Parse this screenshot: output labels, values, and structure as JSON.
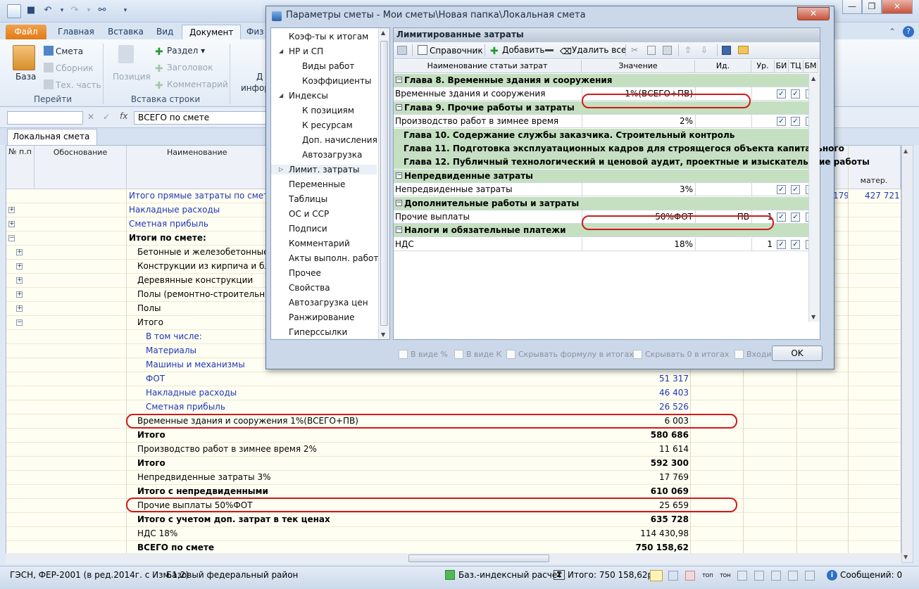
{
  "window": {
    "title_controls": [
      "—",
      "❐",
      "✕"
    ]
  },
  "ribbon": {
    "tabs": [
      "Файл",
      "Главная",
      "Вставка",
      "Вид",
      "Документ",
      "Физ"
    ],
    "active_tab": "Документ",
    "baza": "База",
    "smeta": "Смета",
    "sbornik": "Сборник",
    "tech_part": "Тех. часть",
    "group_go": "Перейти",
    "position": "Позиция",
    "section": "Раздел",
    "header": "Заголовок",
    "comment": "Комментарий",
    "group_insert": "Вставка строки",
    "cut_text1": "Д",
    "cut_text2": "инфор"
  },
  "formula_bar": {
    "fx": "fx",
    "value": "ВСЕГО по смете"
  },
  "doc_tab": {
    "label": "Локальная смета",
    "close": "✕"
  },
  "grid": {
    "headers": {
      "num": "№ п.п",
      "basis": "Обоснование",
      "name": "Наименование",
      "mater": "матер."
    },
    "rows": [
      {
        "name": "Итого прямые затраты по смете с у",
        "value": "",
        "style": "blue",
        "indent": 0,
        "pm": "",
        "extra1": "179",
        "extra2": "427 721"
      },
      {
        "name": "Накладные расходы",
        "value": "",
        "style": "blue",
        "indent": 0,
        "pm": "+"
      },
      {
        "name": "Сметная прибыль",
        "value": "",
        "style": "blue",
        "indent": 0,
        "pm": "+"
      },
      {
        "name": "Итоги по смете:",
        "value": "",
        "style": "b",
        "indent": 0,
        "pm": "−"
      },
      {
        "name": "Бетонные и железобетонные мон",
        "value": "",
        "style": "",
        "indent": 1,
        "pm": "+"
      },
      {
        "name": "Конструкции из кирпича и блоко",
        "value": "",
        "style": "",
        "indent": 1,
        "pm": "+"
      },
      {
        "name": "Деревянные конструкции",
        "value": "",
        "style": "",
        "indent": 1,
        "pm": "+"
      },
      {
        "name": "Полы (ремонтно-строительные)",
        "value": "",
        "style": "",
        "indent": 1,
        "pm": "+"
      },
      {
        "name": "Полы",
        "value": "",
        "style": "",
        "indent": 1,
        "pm": "+"
      },
      {
        "name": "Итого",
        "value": "",
        "style": "",
        "indent": 1,
        "pm": "−"
      },
      {
        "name": "В том числе:",
        "value": "",
        "style": "blue",
        "indent": 2,
        "pm": ""
      },
      {
        "name": "Материалы",
        "value": "",
        "style": "blue",
        "indent": 2,
        "pm": ""
      },
      {
        "name": "Машины и механизмы",
        "value": "",
        "style": "blue",
        "indent": 2,
        "pm": ""
      },
      {
        "name": "ФОТ",
        "value": "51 317",
        "style": "blue",
        "indent": 2,
        "pm": ""
      },
      {
        "name": "Накладные расходы",
        "value": "46 403",
        "style": "blue",
        "indent": 2,
        "pm": ""
      },
      {
        "name": "Сметная прибыль",
        "value": "26 526",
        "style": "blue",
        "indent": 2,
        "pm": ""
      },
      {
        "name": "Временные здания и сооружения 1%(ВСЕГО+ПВ)",
        "value": "6 003",
        "style": "",
        "indent": 1,
        "pm": ""
      },
      {
        "name": "Итого",
        "value": "580 686",
        "style": "b",
        "indent": 1,
        "pm": ""
      },
      {
        "name": "Производство работ в зимнее время 2%",
        "value": "11 614",
        "style": "",
        "indent": 1,
        "pm": ""
      },
      {
        "name": "Итого",
        "value": "592 300",
        "style": "b",
        "indent": 1,
        "pm": ""
      },
      {
        "name": "Непредвиденные затраты 3%",
        "value": "17 769",
        "style": "",
        "indent": 1,
        "pm": ""
      },
      {
        "name": "Итого с непредвиденными",
        "value": "610 069",
        "style": "b",
        "indent": 1,
        "pm": ""
      },
      {
        "name": "Прочие выплаты 50%ФОТ",
        "value": "25 659",
        "style": "",
        "indent": 1,
        "pm": ""
      },
      {
        "name": "Итого с учетом доп. затрат в тек ценах",
        "value": "635 728",
        "style": "b",
        "indent": 1,
        "pm": ""
      },
      {
        "name": "НДС 18%",
        "value": "114 430,98",
        "style": "",
        "indent": 1,
        "pm": ""
      },
      {
        "name": "ВСЕГО по смете",
        "value": "750 158,62",
        "style": "b",
        "indent": 1,
        "pm": ""
      }
    ]
  },
  "status": {
    "left": "ГЭСН, ФЕР-2001 (в ред.2014г. с Изм.1,2)",
    "region": "Базовый федеральный район",
    "calc": "Баз.-индексный расчет",
    "total": "Итого: 750 158,62р.",
    "messages": "Сообщений: 0"
  },
  "dialog": {
    "title": "Параметры сметы - Мои сметы\\Новая папка\\Локальная смета",
    "nav": [
      {
        "label": "Коэф-ты к итогам",
        "level": 0,
        "arrow": ""
      },
      {
        "label": "НР и СП",
        "level": 0,
        "arrow": "◢"
      },
      {
        "label": "Виды работ",
        "level": 1,
        "arrow": ""
      },
      {
        "label": "Коэффициенты",
        "level": 1,
        "arrow": ""
      },
      {
        "label": "Индексы",
        "level": 0,
        "arrow": "◢"
      },
      {
        "label": "К позициям",
        "level": 1,
        "arrow": ""
      },
      {
        "label": "К ресурсам",
        "level": 1,
        "arrow": ""
      },
      {
        "label": "Доп. начисления",
        "level": 1,
        "arrow": ""
      },
      {
        "label": "Автозагрузка",
        "level": 1,
        "arrow": ""
      },
      {
        "label": "Лимит. затраты",
        "level": 0,
        "arrow": "▷"
      },
      {
        "label": "Переменные",
        "level": 0,
        "arrow": ""
      },
      {
        "label": "Таблицы",
        "level": 0,
        "arrow": ""
      },
      {
        "label": "ОС и ССР",
        "level": 0,
        "arrow": ""
      },
      {
        "label": "Подписи",
        "level": 0,
        "arrow": ""
      },
      {
        "label": "Комментарий",
        "level": 0,
        "arrow": ""
      },
      {
        "label": "Акты выполн. работ",
        "level": 0,
        "arrow": ""
      },
      {
        "label": "Прочее",
        "level": 0,
        "arrow": ""
      },
      {
        "label": "Свойства",
        "level": 0,
        "arrow": ""
      },
      {
        "label": "Автозагрузка цен",
        "level": 0,
        "arrow": ""
      },
      {
        "label": "Ранжирование",
        "level": 0,
        "arrow": ""
      },
      {
        "label": "Гиперссылки",
        "level": 0,
        "arrow": ""
      }
    ],
    "panel_title": "Лимитированные затраты",
    "toolbar": {
      "ref": "Справочник",
      "add": "Добавить",
      "delete_all": "Удалить все"
    },
    "columns": {
      "name": "Наименование статьи затрат",
      "value": "Значение",
      "id": "Ид.",
      "level": "Ур.",
      "bi": "БИ",
      "tc": "ТЦ",
      "bm": "БМ"
    },
    "rows": [
      {
        "kind": "sec",
        "name": "Глава 8. Временные здания и сооружения"
      },
      {
        "kind": "item",
        "name": "Временные здания и сооружения",
        "value": "1%(ВСЕГО+ПВ)",
        "id": "",
        "level": ""
      },
      {
        "kind": "sec",
        "name": "Глава 9. Прочие работы и затраты"
      },
      {
        "kind": "item",
        "name": "Производство работ в зимнее время",
        "value": "2%",
        "id": "",
        "level": ""
      },
      {
        "kind": "sub",
        "name": "Глава 10. Содержание службы заказчика. Строительный контроль"
      },
      {
        "kind": "sub",
        "name": "Глава 11. Подготовка эксплуатационных кадров для строящегося объекта капитального"
      },
      {
        "kind": "sub",
        "name": "Глава 12. Публичный технологический и ценовой аудит, проектные и изыскательские работы"
      },
      {
        "kind": "sec",
        "name": "Непредвиденные затраты"
      },
      {
        "kind": "item",
        "name": "Непредвиденные затраты",
        "value": "3%",
        "id": "",
        "level": ""
      },
      {
        "kind": "sec",
        "name": "Дополнительные работы и затраты"
      },
      {
        "kind": "item",
        "name": "Прочие выплаты",
        "value": "50%ФОТ",
        "id": "ПВ",
        "level": "1"
      },
      {
        "kind": "sec",
        "name": "Налоги и обязательные платежи"
      },
      {
        "kind": "item",
        "name": "НДС",
        "value": "18%",
        "id": "",
        "level": "1"
      }
    ],
    "options": [
      "В виде %",
      "В виде К",
      "Скрывать формулу в итогах",
      "Скрывать 0 в итогах",
      "Входит в СМР"
    ],
    "ok": "OK"
  }
}
